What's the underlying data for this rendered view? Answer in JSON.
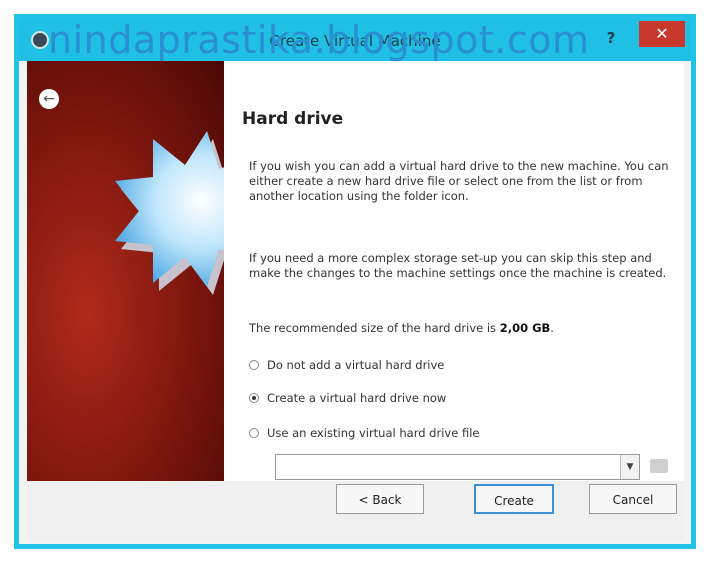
{
  "window": {
    "title": "Create Virtual Machine",
    "help_label": "?",
    "close_label": "✕"
  },
  "watermark": "nindaprastika.blogspot.com",
  "page": {
    "heading": "Hard drive",
    "paragraph1": "If you wish you can add a virtual hard drive to the new machine. You can either create a new hard drive file or select one from the list or from another location using the folder icon.",
    "paragraph2": "If you need a more complex storage set-up you can skip this step and make the changes to the machine settings once the machine is created.",
    "recommended_prefix": "The recommended size of the hard drive is ",
    "recommended_size": "2,00 GB",
    "recommended_suffix": "."
  },
  "options": [
    {
      "label": "Do not add a virtual hard drive",
      "selected": false
    },
    {
      "label": "Create a virtual hard drive now",
      "selected": true
    },
    {
      "label": "Use an existing virtual hard drive file",
      "selected": false
    }
  ],
  "combo": {
    "value": ""
  },
  "buttons": {
    "back": "< Back",
    "create": "Create",
    "cancel": "Cancel"
  },
  "icons": {
    "app": "virtualbox-icon",
    "back": "back-arrow-icon",
    "folder": "folder-icon"
  },
  "colors": {
    "titlebar": "#1fc0e4",
    "close": "#c9382c",
    "sidebar": "#7b160d"
  }
}
